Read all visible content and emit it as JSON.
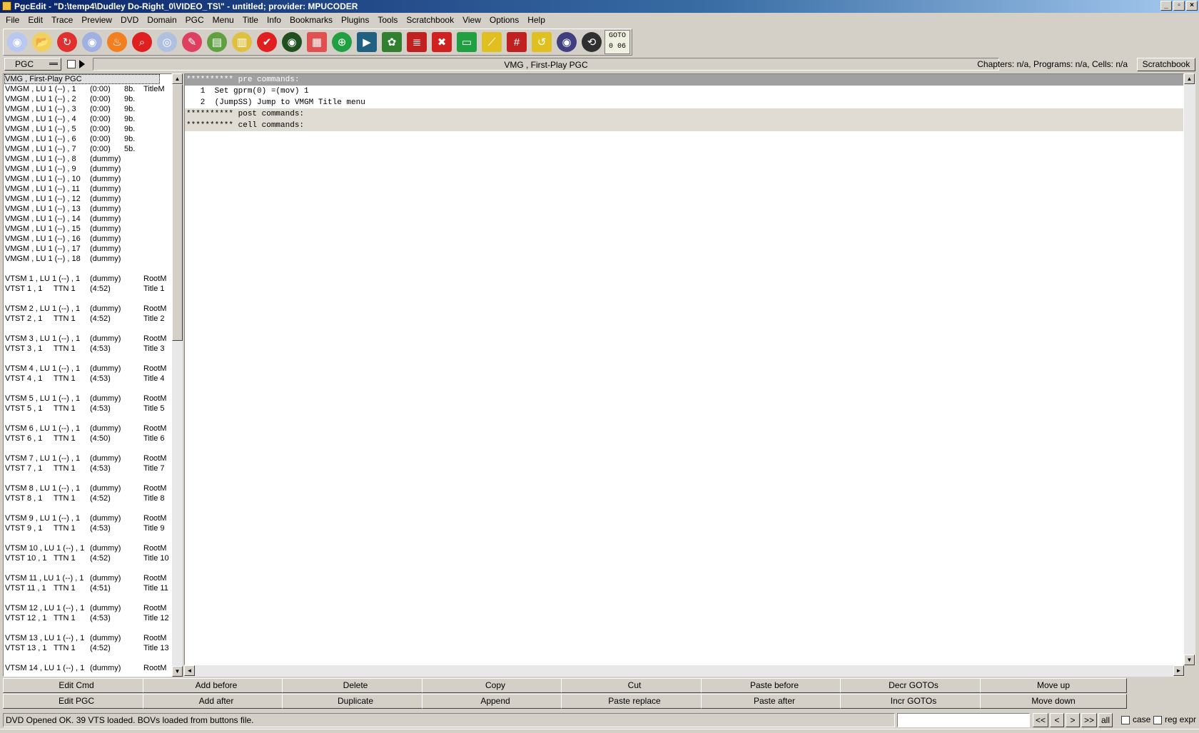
{
  "window": {
    "title": "PgcEdit -  \"D:\\temp4\\Dudley Do-Right_0\\VIDEO_TS\\\" - untitled; provider: MPUCODER"
  },
  "menu": [
    "File",
    "Edit",
    "Trace",
    "Preview",
    "DVD",
    "Domain",
    "PGC",
    "Menu",
    "Title",
    "Info",
    "Bookmarks",
    "Plugins",
    "Tools",
    "Scratchbook",
    "View",
    "Options",
    "Help"
  ],
  "toolbar": {
    "icons": [
      "open-dvd-icon",
      "open-folder-icon",
      "reload-icon",
      "new-dvd-icon",
      "burn-icon",
      "search-icon",
      "disc-compare-icon",
      "disc-edit-icon",
      "save-icon",
      "export-icon",
      "check-icon",
      "disc-info-icon",
      "copy-icon",
      "globe-icon",
      "preview-icon",
      "film-icon",
      "menu-list-icon",
      "delete-menu-icon",
      "menu-icon",
      "link-icon",
      "numbers-search-icon",
      "tcl-icon",
      "eye-icon",
      "navigate-icon"
    ],
    "colors": [
      "#b8c8f0",
      "#f0d060",
      "#e03030",
      "#a0b0e0",
      "#f08020",
      "#e02020",
      "#b0c0e0",
      "#e04060",
      "#60a040",
      "#e0c040",
      "#e02020",
      "#205020",
      "#e05050",
      "#20a040",
      "#206080",
      "#308030",
      "#c02020",
      "#d02020",
      "#20a040",
      "#e0c020",
      "#c02020",
      "#e0c020",
      "#404080",
      "#303030"
    ],
    "goto_line1": "GOTO",
    "goto_line2": "0 06"
  },
  "header": {
    "pgc_selector": "PGC",
    "pgc_name": "VMG , First-Play PGC",
    "info": "Chapters: n/a,  Programs: n/a,  Cells: n/a",
    "scratchbook_button": "Scratchbook"
  },
  "pgc_list": [
    {
      "c1": "VMG , First-Play PGC",
      "c2": "",
      "c3": "",
      "c4": "",
      "c5": ""
    },
    {
      "c1": "VMGM , LU 1 (--) , 1",
      "c2": "",
      "c3": "(0:00)",
      "c4": "8b.",
      "c5": "TitleM"
    },
    {
      "c1": "VMGM , LU 1 (--) , 2",
      "c2": "",
      "c3": "(0:00)",
      "c4": "9b.",
      "c5": ""
    },
    {
      "c1": "VMGM , LU 1 (--) , 3",
      "c2": "",
      "c3": "(0:00)",
      "c4": "9b.",
      "c5": ""
    },
    {
      "c1": "VMGM , LU 1 (--) , 4",
      "c2": "",
      "c3": "(0:00)",
      "c4": "9b.",
      "c5": ""
    },
    {
      "c1": "VMGM , LU 1 (--) , 5",
      "c2": "",
      "c3": "(0:00)",
      "c4": "9b.",
      "c5": ""
    },
    {
      "c1": "VMGM , LU 1 (--) , 6",
      "c2": "",
      "c3": "(0:00)",
      "c4": "9b.",
      "c5": ""
    },
    {
      "c1": "VMGM , LU 1 (--) , 7",
      "c2": "",
      "c3": "(0:00)",
      "c4": "5b.",
      "c5": ""
    },
    {
      "c1": "VMGM , LU 1 (--) , 8",
      "c2": "",
      "c3": "(dummy)",
      "c4": "",
      "c5": ""
    },
    {
      "c1": "VMGM , LU 1 (--) , 9",
      "c2": "",
      "c3": "(dummy)",
      "c4": "",
      "c5": ""
    },
    {
      "c1": "VMGM , LU 1 (--) , 10",
      "c2": "",
      "c3": "(dummy)",
      "c4": "",
      "c5": ""
    },
    {
      "c1": "VMGM , LU 1 (--) , 11",
      "c2": "",
      "c3": "(dummy)",
      "c4": "",
      "c5": ""
    },
    {
      "c1": "VMGM , LU 1 (--) , 12",
      "c2": "",
      "c3": "(dummy)",
      "c4": "",
      "c5": ""
    },
    {
      "c1": "VMGM , LU 1 (--) , 13",
      "c2": "",
      "c3": "(dummy)",
      "c4": "",
      "c5": ""
    },
    {
      "c1": "VMGM , LU 1 (--) , 14",
      "c2": "",
      "c3": "(dummy)",
      "c4": "",
      "c5": ""
    },
    {
      "c1": "VMGM , LU 1 (--) , 15",
      "c2": "",
      "c3": "(dummy)",
      "c4": "",
      "c5": ""
    },
    {
      "c1": "VMGM , LU 1 (--) , 16",
      "c2": "",
      "c3": "(dummy)",
      "c4": "",
      "c5": ""
    },
    {
      "c1": "VMGM , LU 1 (--) , 17",
      "c2": "",
      "c3": "(dummy)",
      "c4": "",
      "c5": ""
    },
    {
      "c1": "VMGM , LU 1 (--) , 18",
      "c2": "",
      "c3": "(dummy)",
      "c4": "",
      "c5": ""
    },
    {
      "c1": "",
      "c2": "",
      "c3": "",
      "c4": "",
      "c5": ""
    },
    {
      "c1": "VTSM 1 , LU 1 (--) , 1",
      "c2": "",
      "c3": "(dummy)",
      "c4": "",
      "c5": "RootM"
    },
    {
      "c1": "VTST 1 , 1",
      "c2": "TTN 1",
      "c3": "(4:52)",
      "c4": "",
      "c5": "Title 1"
    },
    {
      "c1": "",
      "c2": "",
      "c3": "",
      "c4": "",
      "c5": ""
    },
    {
      "c1": "VTSM 2 , LU 1 (--) , 1",
      "c2": "",
      "c3": "(dummy)",
      "c4": "",
      "c5": "RootM"
    },
    {
      "c1": "VTST 2 , 1",
      "c2": "TTN 1",
      "c3": "(4:52)",
      "c4": "",
      "c5": "Title 2"
    },
    {
      "c1": "",
      "c2": "",
      "c3": "",
      "c4": "",
      "c5": ""
    },
    {
      "c1": "VTSM 3 , LU 1 (--) , 1",
      "c2": "",
      "c3": "(dummy)",
      "c4": "",
      "c5": "RootM"
    },
    {
      "c1": "VTST 3 , 1",
      "c2": "TTN 1",
      "c3": "(4:53)",
      "c4": "",
      "c5": "Title 3"
    },
    {
      "c1": "",
      "c2": "",
      "c3": "",
      "c4": "",
      "c5": ""
    },
    {
      "c1": "VTSM 4 , LU 1 (--) , 1",
      "c2": "",
      "c3": "(dummy)",
      "c4": "",
      "c5": "RootM"
    },
    {
      "c1": "VTST 4 , 1",
      "c2": "TTN 1",
      "c3": "(4:53)",
      "c4": "",
      "c5": "Title 4"
    },
    {
      "c1": "",
      "c2": "",
      "c3": "",
      "c4": "",
      "c5": ""
    },
    {
      "c1": "VTSM 5 , LU 1 (--) , 1",
      "c2": "",
      "c3": "(dummy)",
      "c4": "",
      "c5": "RootM"
    },
    {
      "c1": "VTST 5 , 1",
      "c2": "TTN 1",
      "c3": "(4:53)",
      "c4": "",
      "c5": "Title 5"
    },
    {
      "c1": "",
      "c2": "",
      "c3": "",
      "c4": "",
      "c5": ""
    },
    {
      "c1": "VTSM 6 , LU 1 (--) , 1",
      "c2": "",
      "c3": "(dummy)",
      "c4": "",
      "c5": "RootM"
    },
    {
      "c1": "VTST 6 , 1",
      "c2": "TTN 1",
      "c3": "(4:50)",
      "c4": "",
      "c5": "Title 6"
    },
    {
      "c1": "",
      "c2": "",
      "c3": "",
      "c4": "",
      "c5": ""
    },
    {
      "c1": "VTSM 7 , LU 1 (--) , 1",
      "c2": "",
      "c3": "(dummy)",
      "c4": "",
      "c5": "RootM"
    },
    {
      "c1": "VTST 7 , 1",
      "c2": "TTN 1",
      "c3": "(4:53)",
      "c4": "",
      "c5": "Title 7"
    },
    {
      "c1": "",
      "c2": "",
      "c3": "",
      "c4": "",
      "c5": ""
    },
    {
      "c1": "VTSM 8 , LU 1 (--) , 1",
      "c2": "",
      "c3": "(dummy)",
      "c4": "",
      "c5": "RootM"
    },
    {
      "c1": "VTST 8 , 1",
      "c2": "TTN 1",
      "c3": "(4:52)",
      "c4": "",
      "c5": "Title 8"
    },
    {
      "c1": "",
      "c2": "",
      "c3": "",
      "c4": "",
      "c5": ""
    },
    {
      "c1": "VTSM 9 , LU 1 (--) , 1",
      "c2": "",
      "c3": "(dummy)",
      "c4": "",
      "c5": "RootM"
    },
    {
      "c1": "VTST 9 , 1",
      "c2": "TTN 1",
      "c3": "(4:53)",
      "c4": "",
      "c5": "Title 9"
    },
    {
      "c1": "",
      "c2": "",
      "c3": "",
      "c4": "",
      "c5": ""
    },
    {
      "c1": "VTSM 10 , LU 1 (--) , 1",
      "c2": "",
      "c3": "(dummy)",
      "c4": "",
      "c5": "RootM"
    },
    {
      "c1": "VTST 10 , 1",
      "c2": "TTN 1",
      "c3": "(4:52)",
      "c4": "",
      "c5": "Title 10"
    },
    {
      "c1": "",
      "c2": "",
      "c3": "",
      "c4": "",
      "c5": ""
    },
    {
      "c1": "VTSM 11 , LU 1 (--) , 1",
      "c2": "",
      "c3": "(dummy)",
      "c4": "",
      "c5": "RootM"
    },
    {
      "c1": "VTST 11 , 1",
      "c2": "TTN 1",
      "c3": "(4:51)",
      "c4": "",
      "c5": "Title 11"
    },
    {
      "c1": "",
      "c2": "",
      "c3": "",
      "c4": "",
      "c5": ""
    },
    {
      "c1": "VTSM 12 , LU 1 (--) , 1",
      "c2": "",
      "c3": "(dummy)",
      "c4": "",
      "c5": "RootM"
    },
    {
      "c1": "VTST 12 , 1",
      "c2": "TTN 1",
      "c3": "(4:53)",
      "c4": "",
      "c5": "Title 12"
    },
    {
      "c1": "",
      "c2": "",
      "c3": "",
      "c4": "",
      "c5": ""
    },
    {
      "c1": "VTSM 13 , LU 1 (--) , 1",
      "c2": "",
      "c3": "(dummy)",
      "c4": "",
      "c5": "RootM"
    },
    {
      "c1": "VTST 13 , 1",
      "c2": "TTN 1",
      "c3": "(4:52)",
      "c4": "",
      "c5": "Title 13"
    },
    {
      "c1": "",
      "c2": "",
      "c3": "",
      "c4": "",
      "c5": ""
    },
    {
      "c1": "VTSM 14 , LU 1 (--) , 1",
      "c2": "",
      "c3": "(dummy)",
      "c4": "",
      "c5": "RootM"
    }
  ],
  "commands": [
    {
      "text": "********** pre commands:",
      "style": "hdr1"
    },
    {
      "text": "   1  Set gprm(0) =(mov) 1",
      "style": ""
    },
    {
      "text": "   2  (JumpSS) Jump to VMGM Title menu",
      "style": ""
    },
    {
      "text": "********** post commands:",
      "style": "hdr2"
    },
    {
      "text": "********** cell commands:",
      "style": "hdr2"
    }
  ],
  "buttons_row1": [
    "Edit Cmd",
    "Add before",
    "Delete",
    "Copy",
    "Cut",
    "Paste before",
    "Decr GOTOs",
    "Move up"
  ],
  "buttons_row2": [
    "Edit PGC",
    "Add after",
    "Duplicate",
    "Append",
    "Paste replace",
    "Paste after",
    "Incr GOTOs",
    "Move down"
  ],
  "status": {
    "text": "DVD Opened OK.  39 VTS loaded.  BOVs loaded from buttons file.",
    "search_value": "",
    "nav": [
      "<<",
      "<",
      ">",
      ">>",
      "all"
    ],
    "case_label": "case",
    "regexp_label": "reg expr"
  }
}
